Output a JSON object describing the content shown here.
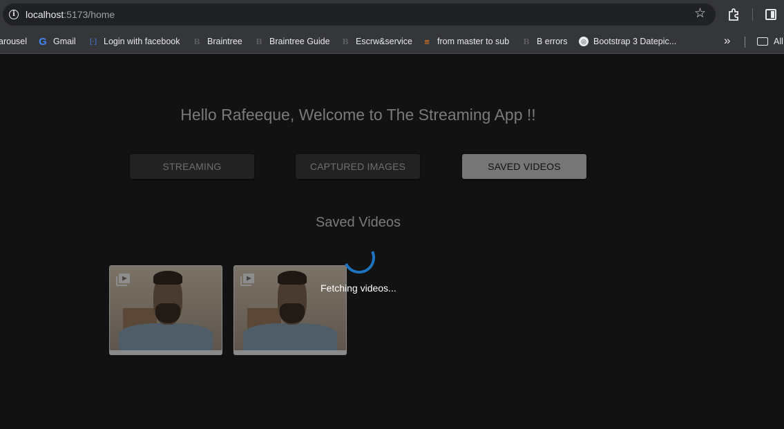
{
  "browser": {
    "url_host": "localhost",
    "url_path": ":5173/home",
    "bookmarks": [
      {
        "label": "arousel",
        "icon": "none"
      },
      {
        "label": "Gmail",
        "icon": "google-icon"
      },
      {
        "label": "Login with facebook",
        "icon": "facebook-icon"
      },
      {
        "label": "Braintree",
        "icon": "b-icon"
      },
      {
        "label": "Braintree Guide",
        "icon": "b-icon"
      },
      {
        "label": "Escrw&service",
        "icon": "b-icon"
      },
      {
        "label": "from master to sub",
        "icon": "stackoverflow-icon"
      },
      {
        "label": "B errors",
        "icon": "b-icon"
      },
      {
        "label": "Bootstrap 3 Datepic...",
        "icon": "globe-icon"
      }
    ],
    "all_bookmarks_label": "All"
  },
  "page": {
    "welcome": "Hello Rafeeque, Welcome to The Streaming App !!",
    "tabs": [
      {
        "label": "STREAMING",
        "active": false
      },
      {
        "label": "CAPTURED IMAGES",
        "active": false
      },
      {
        "label": "SAVED VIDEOS",
        "active": true
      }
    ],
    "section_title": "Saved Videos",
    "loading_text": "Fetching videos...",
    "videos": [
      {
        "icon": "video-library-icon"
      },
      {
        "icon": "video-library-icon"
      }
    ],
    "colors": {
      "background": "#121212",
      "active_tab": "#767676",
      "spinner": "#1e73be"
    }
  }
}
